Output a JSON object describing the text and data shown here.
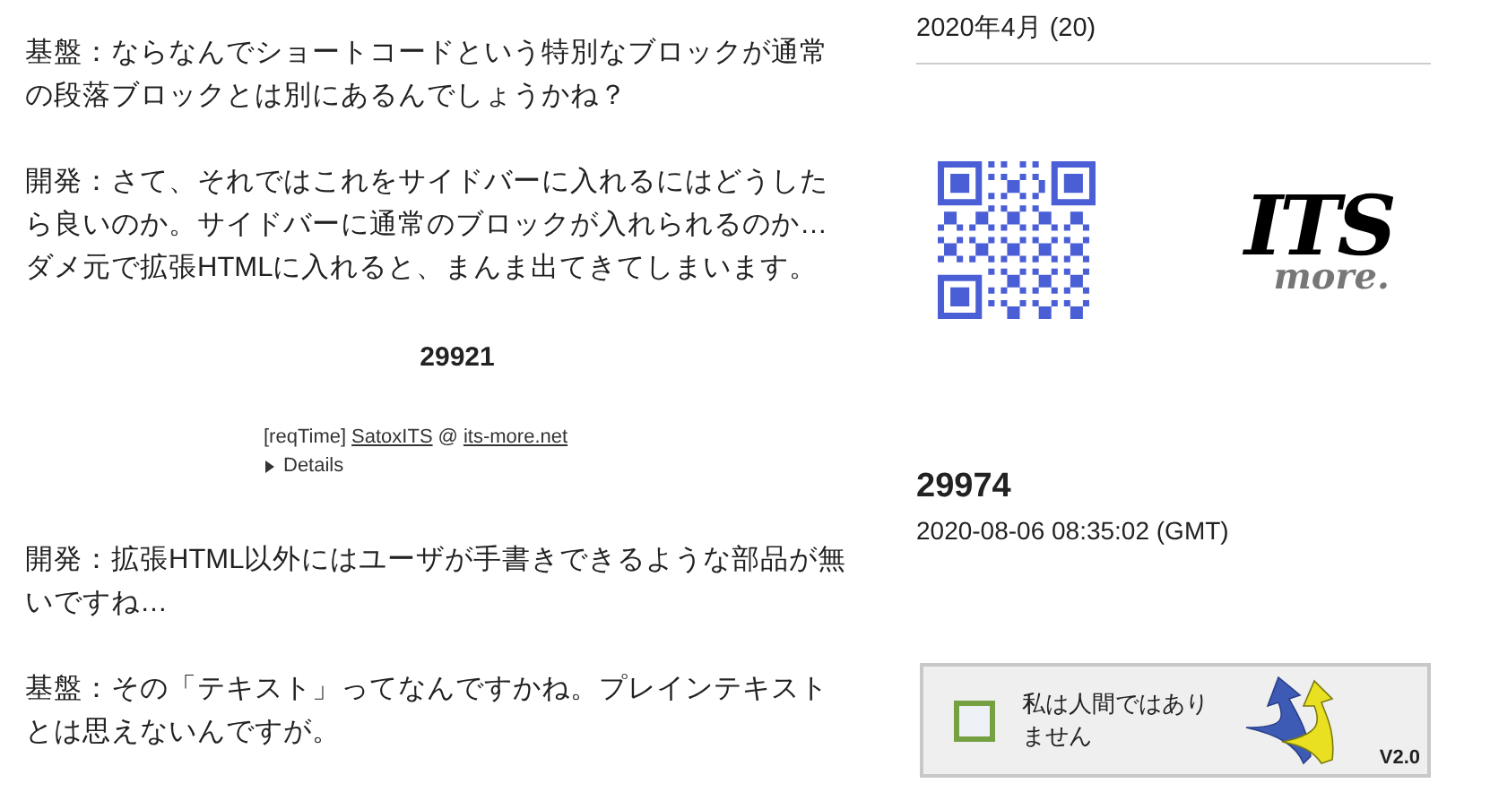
{
  "main": {
    "paragraphs_top": [
      "基盤：ならなんでショートコードという特別なブロックが通常の段落ブロックとは別にあるんでしょうかね？",
      "開発：さて、それではこれをサイドバーに入れるにはどうしたら良いのか。サイドバーに通常のブロックが入れられるのか…\nダメ元で拡張HTMLに入れると、まんま出てきてしまいます。"
    ],
    "counter": "29921",
    "meta": {
      "prefix": "[reqTime]",
      "author": "SatoxITS",
      "at": "@",
      "site": "its-more.net",
      "details": "Details",
      "expanded": false
    },
    "paragraphs_bottom": [
      "開発：拡張HTML以外にはユーザが手書きできるような部品が無いですね…",
      "基盤：その「テキスト」ってなんですかね。プレインテキストとは思えないんですが。"
    ]
  },
  "sidebar": {
    "archive": "2020年4月 (20)",
    "logo": {
      "line1": "ITS",
      "line2": "more."
    },
    "counter": "29974",
    "timestamp": "2020-08-06 08:35:02 (GMT)",
    "captcha": {
      "label": "私は人間ではありません",
      "checked": false,
      "version": "V2.0"
    }
  }
}
